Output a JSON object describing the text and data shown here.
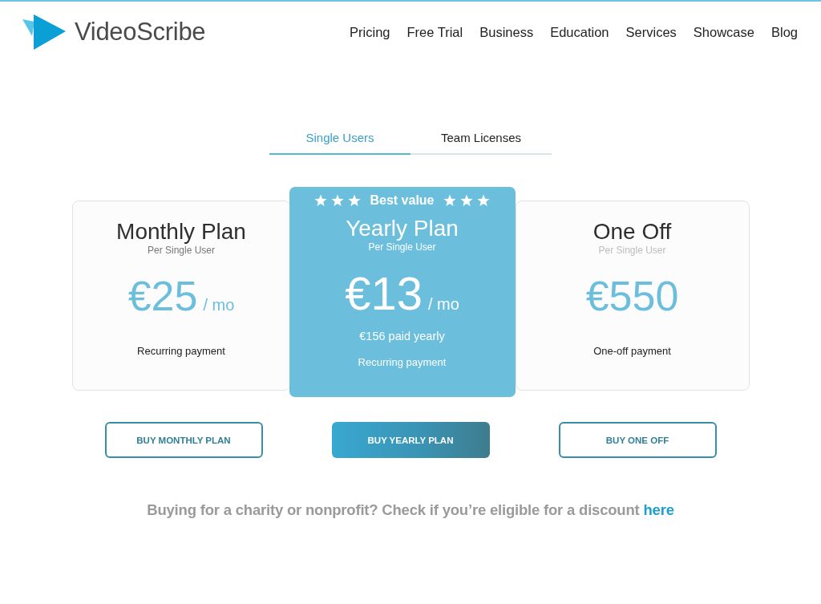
{
  "header": {
    "logo": {
      "text": "VideoScribe"
    },
    "nav": [
      {
        "label": "Pricing"
      },
      {
        "label": "Free Trial"
      },
      {
        "label": "Business"
      },
      {
        "label": "Education"
      },
      {
        "label": "Services"
      },
      {
        "label": "Showcase"
      },
      {
        "label": "Blog"
      }
    ]
  },
  "tabs": [
    {
      "label": "Single Users",
      "selected": true
    },
    {
      "label": "Team Licenses",
      "selected": false
    }
  ],
  "plans": [
    {
      "title": "Monthly Plan",
      "subtitle": "Per Single User",
      "subtitle_faded": false,
      "price": "€25",
      "period": "/ mo",
      "payment": "Recurring payment",
      "featured": false
    },
    {
      "badge": "Best value",
      "title": "Yearly Plan",
      "subtitle": "Per Single User",
      "subtitle_faded": false,
      "price": "€13",
      "period": "/ mo",
      "note": "€156 paid yearly",
      "payment": "Recurring payment",
      "featured": true
    },
    {
      "title": "One Off",
      "subtitle": "Per Single User",
      "subtitle_faded": true,
      "price": "€550",
      "payment": "One-off payment",
      "featured": false
    }
  ],
  "buttons": [
    {
      "label": "BUY MONTHLY PLAN",
      "kind": "outline"
    },
    {
      "label": "BUY YEARLY PLAN",
      "kind": "filled"
    },
    {
      "label": "BUY ONE OFF",
      "kind": "outline"
    }
  ],
  "discount_notice": {
    "text": "Buying for a charity or nonprofit? Check if you’re eligible for a discount",
    "link": "here"
  }
}
